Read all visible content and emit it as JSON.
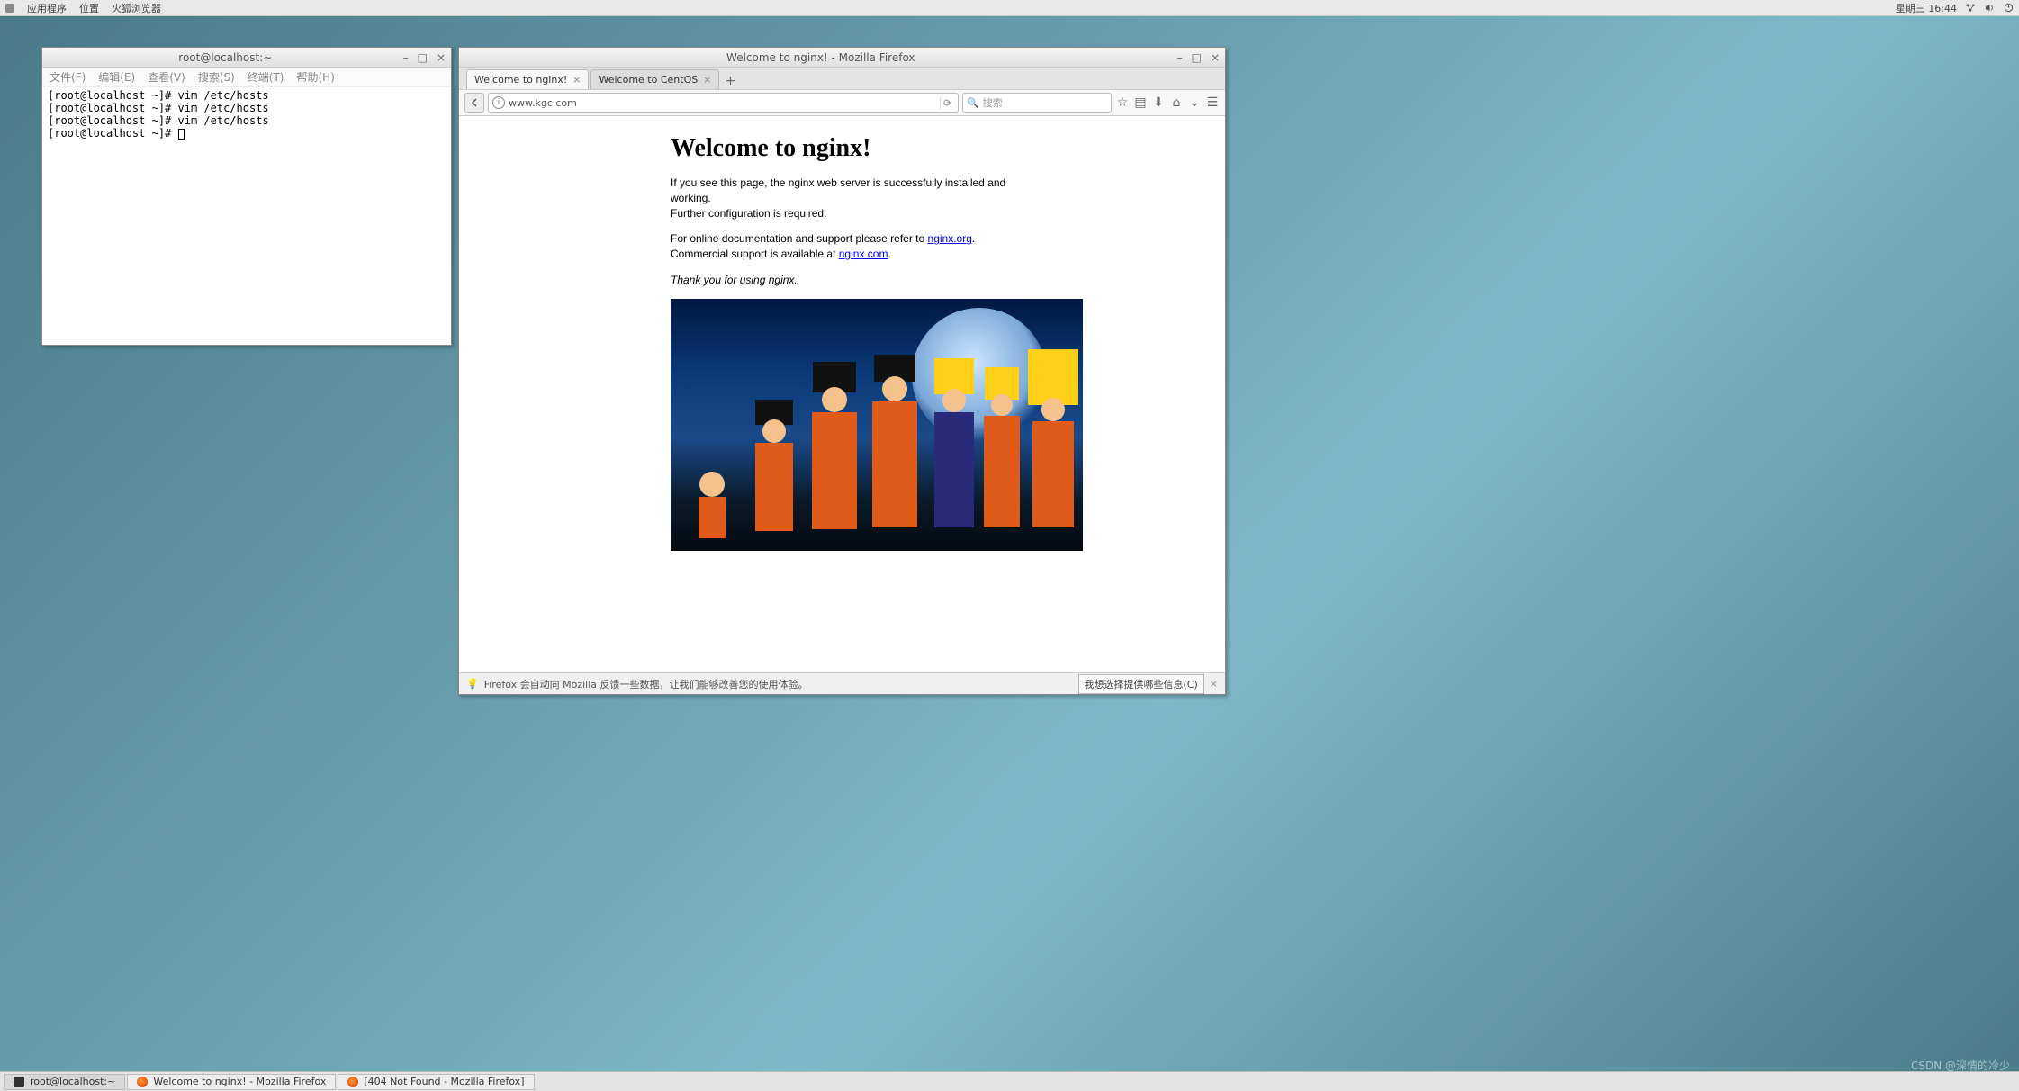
{
  "panel": {
    "apps": "应用程序",
    "places": "位置",
    "firefox": "火狐浏览器",
    "datetime": "星期三 16:44"
  },
  "terminal": {
    "title": "root@localhost:~",
    "menu": {
      "file": "文件(F)",
      "edit": "编辑(E)",
      "view": "查看(V)",
      "search": "搜索(S)",
      "terminal": "终端(T)",
      "help": "帮助(H)"
    },
    "lines": [
      "[root@localhost ~]# vim /etc/hosts",
      "[root@localhost ~]# vim /etc/hosts",
      "[root@localhost ~]# vim /etc/hosts",
      "[root@localhost ~]# "
    ]
  },
  "firefox": {
    "title": "Welcome to nginx! - Mozilla Firefox",
    "tabs": [
      {
        "label": "Welcome to nginx!",
        "active": true
      },
      {
        "label": "Welcome to CentOS",
        "active": false
      }
    ],
    "url": "www.kgc.com",
    "search_placeholder": "搜索",
    "status_text": "Firefox 会自动向 Mozilla 反馈一些数据，让我们能够改善您的使用体验。",
    "status_button": "我想选择提供哪些信息(C)"
  },
  "page": {
    "heading": "Welcome to nginx!",
    "p1a": "If you see this page, the nginx web server is successfully installed and working.",
    "p1b": "Further configuration is required.",
    "p2a": "For online documentation and support please refer to ",
    "link1": "nginx.org",
    "p2b": ".",
    "p2c": "Commercial support is available at ",
    "link2": "nginx.com",
    "p2d": ".",
    "p3": "Thank you for using nginx."
  },
  "taskbar": {
    "item1": "root@localhost:~",
    "item2": "Welcome to nginx! - Mozilla Firefox",
    "item3": "[404 Not Found - Mozilla Firefox]"
  },
  "watermark": "CSDN @深情的冷少"
}
